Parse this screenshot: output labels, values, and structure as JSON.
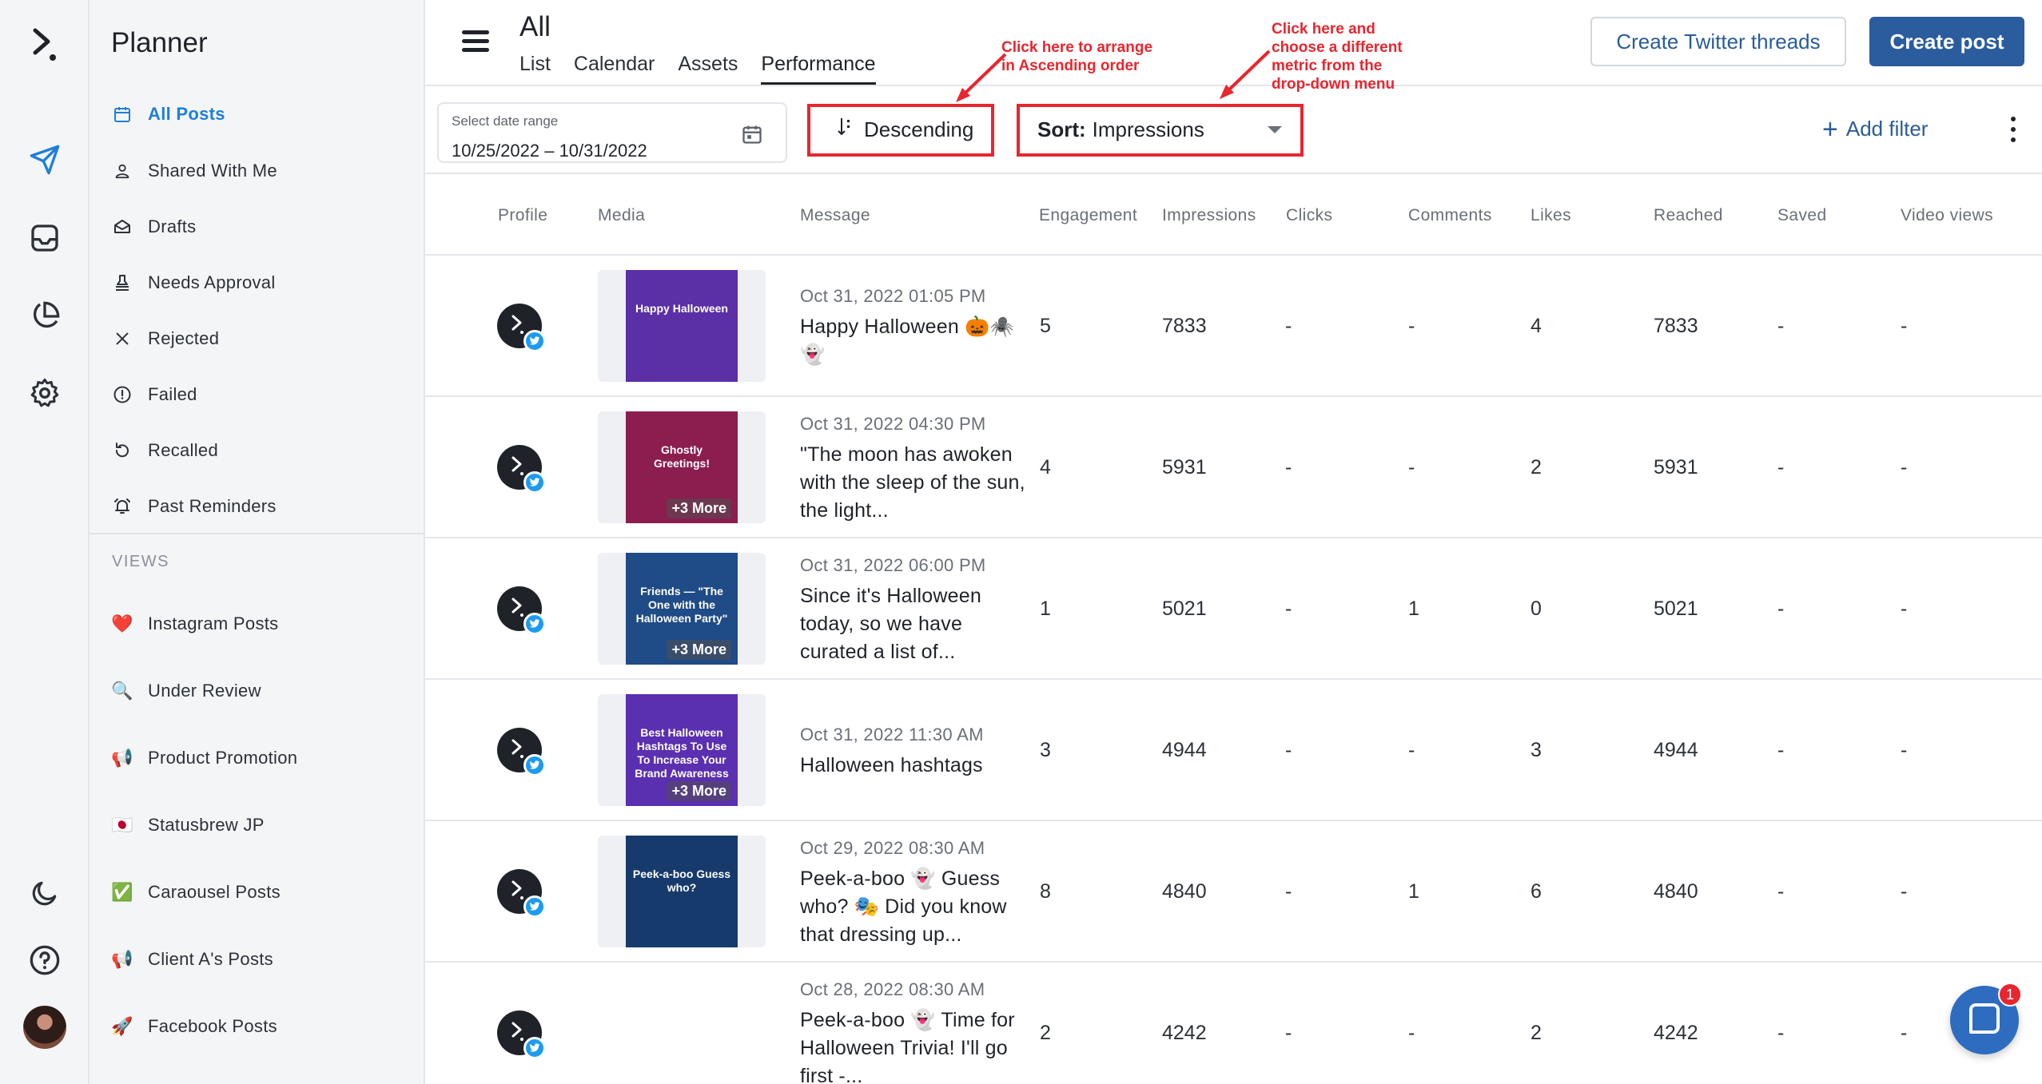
{
  "app": {
    "rail": {
      "logo_icon": "statusbrew-logo-icon",
      "items": [
        "send-icon",
        "inbox-icon",
        "pie-chart-icon",
        "gear-icon"
      ],
      "bottom": [
        "moon-icon",
        "help-icon",
        "avatar"
      ]
    }
  },
  "sidebar": {
    "title": "Planner",
    "items": [
      {
        "label": "All Posts",
        "icon": "calendar-icon",
        "active": true
      },
      {
        "label": "Shared With Me",
        "icon": "person-icon"
      },
      {
        "label": "Drafts",
        "icon": "draft-icon"
      },
      {
        "label": "Needs Approval",
        "icon": "stamp-icon"
      },
      {
        "label": "Rejected",
        "icon": "x-icon"
      },
      {
        "label": "Failed",
        "icon": "alert-circle-icon"
      },
      {
        "label": "Recalled",
        "icon": "undo-icon"
      },
      {
        "label": "Past Reminders",
        "icon": "alarm-icon"
      }
    ],
    "views_heading": "VIEWS",
    "views": [
      {
        "label": "Instagram Posts",
        "emoji": "❤️"
      },
      {
        "label": "Under Review",
        "emoji": "🔍"
      },
      {
        "label": "Product Promotion",
        "emoji": "📢"
      },
      {
        "label": "Statusbrew JP",
        "emoji": "🇯🇵"
      },
      {
        "label": "Caraousel Posts",
        "emoji": "✅"
      },
      {
        "label": "Client A's Posts",
        "emoji": "📢"
      },
      {
        "label": "Facebook Posts",
        "emoji": "🚀"
      }
    ]
  },
  "header": {
    "title": "All",
    "tabs": [
      "List",
      "Calendar",
      "Assets",
      "Performance"
    ],
    "active_tab": "Performance",
    "create_threads": "Create Twitter threads",
    "create_post": "Create post"
  },
  "annotations": {
    "ascending": "Click here to arrange\nin Ascending order",
    "metric": "Click here and\nchoose a different\nmetric from the\ndrop-down menu",
    "color": "#e8262f"
  },
  "toolbar": {
    "date_label": "Select date range",
    "date_value": "10/25/2022 – 10/31/2022",
    "sort_direction": "Descending",
    "sort_prefix": "Sort:",
    "sort_metric": "Impressions",
    "add_filter": "Add filter"
  },
  "table": {
    "columns": [
      "Profile",
      "Media",
      "Message",
      "Engagement",
      "Impressions",
      "Clicks",
      "Comments",
      "Likes",
      "Reached",
      "Saved",
      "Video views"
    ],
    "rows": [
      {
        "date": "Oct 31, 2022 01:05 PM",
        "message": "Happy Halloween 🎃🕷️ 👻",
        "thumb_title": "Happy Halloween",
        "thumb_color": "#5b2fa6",
        "more": "",
        "engagement": "5",
        "impressions": "7833",
        "clicks": "-",
        "comments": "-",
        "likes": "4",
        "reached": "7833",
        "saved": "-",
        "video_views": "-"
      },
      {
        "date": "Oct 31, 2022 04:30 PM",
        "message": "\"The moon has awoken with the sleep of the sun, the light...",
        "thumb_title": "Ghostly Greetings!",
        "thumb_color": "#8c1d4f",
        "more": "+3 More",
        "engagement": "4",
        "impressions": "5931",
        "clicks": "-",
        "comments": "-",
        "likes": "2",
        "reached": "5931",
        "saved": "-",
        "video_views": "-"
      },
      {
        "date": "Oct 31, 2022 06:00 PM",
        "message": "Since it's Halloween today, so we have curated a list of...",
        "thumb_title": "Friends — \"The One with the Halloween Party\"",
        "thumb_color": "#1f4b87",
        "more": "+3 More",
        "engagement": "1",
        "impressions": "5021",
        "clicks": "-",
        "comments": "1",
        "likes": "0",
        "reached": "5021",
        "saved": "-",
        "video_views": "-"
      },
      {
        "date": "Oct 31, 2022 11:30 AM",
        "message": "Halloween hashtags",
        "thumb_title": "Best Halloween Hashtags To Use To Increase Your Brand Awareness",
        "thumb_color": "#5a2fb0",
        "more": "+3 More",
        "engagement": "3",
        "impressions": "4944",
        "clicks": "-",
        "comments": "-",
        "likes": "3",
        "reached": "4944",
        "saved": "-",
        "video_views": "-"
      },
      {
        "date": "Oct 29, 2022 08:30 AM",
        "message": "Peek-a-boo 👻 Guess who? 🎭 Did you know that dressing up...",
        "thumb_title": "Peek-a-boo Guess who?",
        "thumb_color": "#163a6b",
        "more": "",
        "engagement": "8",
        "impressions": "4840",
        "clicks": "-",
        "comments": "1",
        "likes": "6",
        "reached": "4840",
        "saved": "-",
        "video_views": "-"
      },
      {
        "date": "Oct 28, 2022 08:30 AM",
        "message": "Peek-a-boo 👻 Time for Halloween Trivia! I'll go first -...",
        "thumb_title": "",
        "thumb_color": "",
        "more": "",
        "engagement": "2",
        "impressions": "4242",
        "clicks": "-",
        "comments": "-",
        "likes": "2",
        "reached": "4242",
        "saved": "-",
        "video_views": "-"
      }
    ]
  },
  "chat": {
    "badge": "1"
  }
}
